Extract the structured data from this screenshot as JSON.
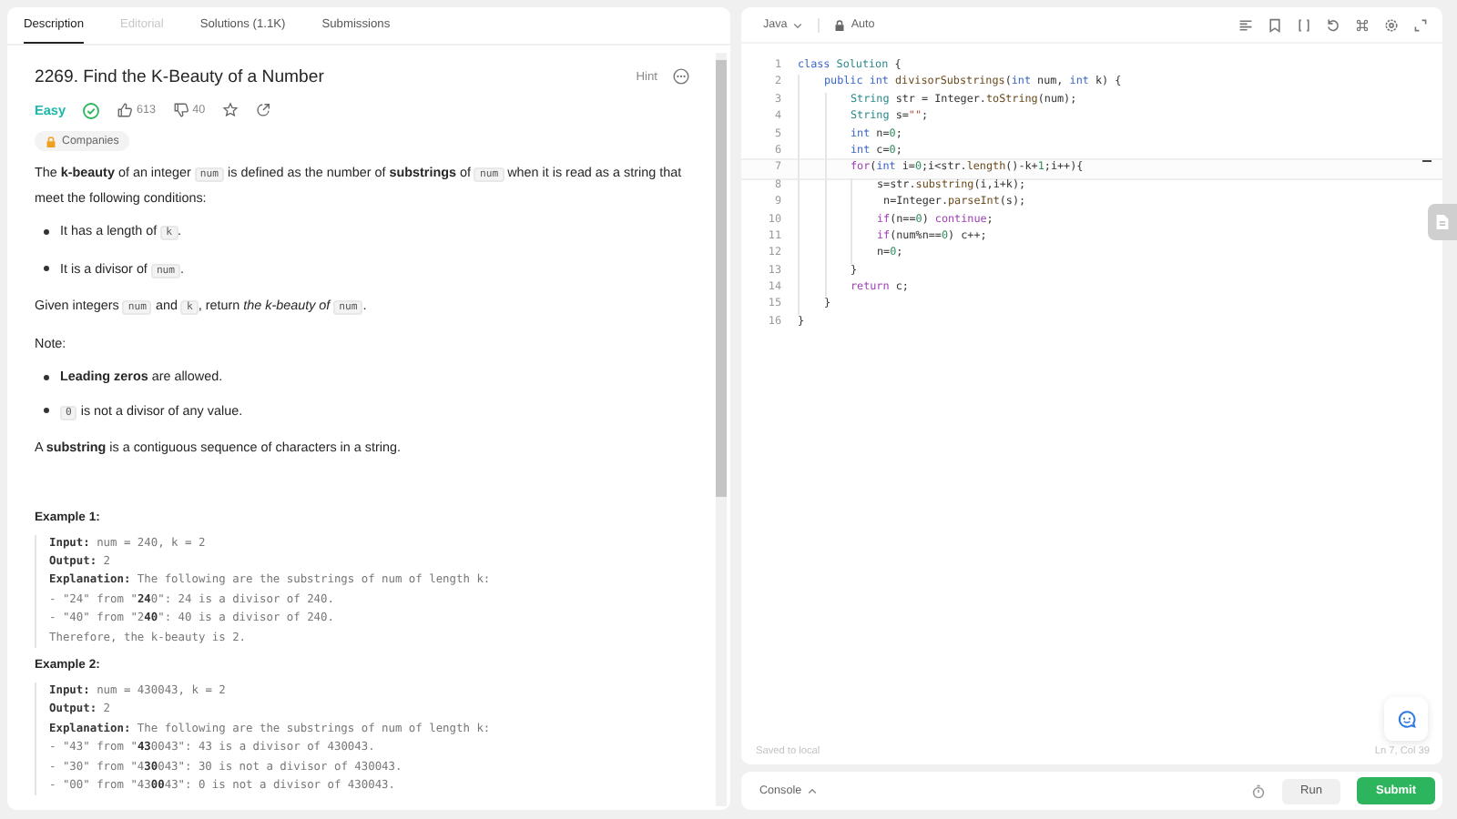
{
  "tabs": [
    {
      "label": "Description",
      "selected": true,
      "disabled": false
    },
    {
      "label": "Editorial",
      "selected": false,
      "disabled": true
    },
    {
      "label": "Solutions (1.1K)",
      "selected": false,
      "disabled": false
    },
    {
      "label": "Submissions",
      "selected": false,
      "disabled": false
    }
  ],
  "problem": {
    "title": "2269. Find the K-Beauty of a Number",
    "hint": "Hint",
    "difficulty": "Easy",
    "solved": true,
    "likes": "613",
    "dislikes": "40",
    "companies": "Companies"
  },
  "description": [
    {
      "kind": "p",
      "parts": [
        {
          "kind": "text",
          "text": "The **k-beauty** of an integer "
        },
        {
          "kind": "code",
          "text": "num"
        },
        {
          "kind": "text",
          "text": " is defined as the number of **substrings** of "
        },
        {
          "kind": "code",
          "text": "num"
        },
        {
          "kind": "text",
          "text": " when it is read as a string that meet the following conditions:"
        }
      ]
    },
    {
      "kind": "li",
      "parts": [
        {
          "kind": "text",
          "text": "It has a length of "
        },
        {
          "kind": "code",
          "text": "k"
        },
        {
          "kind": "text",
          "text": "."
        }
      ]
    },
    {
      "kind": "li",
      "parts": [
        {
          "kind": "text",
          "text": "It is a divisor of "
        },
        {
          "kind": "code",
          "text": "num"
        },
        {
          "kind": "text",
          "text": "."
        }
      ]
    },
    {
      "kind": "p",
      "parts": [
        {
          "kind": "text",
          "text": "Given integers "
        },
        {
          "kind": "code",
          "text": "num"
        },
        {
          "kind": "text",
          "text": " and "
        },
        {
          "kind": "code",
          "text": "k"
        },
        {
          "kind": "text",
          "text": ", return *the k-beauty of* "
        },
        {
          "kind": "code",
          "text": "num"
        },
        {
          "kind": "text",
          "text": "."
        }
      ]
    },
    {
      "kind": "p",
      "parts": [
        {
          "kind": "text",
          "text": "Note:"
        }
      ]
    },
    {
      "kind": "li",
      "parts": [
        {
          "kind": "text",
          "text": "**Leading zeros** are allowed."
        }
      ]
    },
    {
      "kind": "li",
      "parts": [
        {
          "kind": "code",
          "text": "0"
        },
        {
          "kind": "text",
          "text": " is not a divisor of any value."
        }
      ]
    },
    {
      "kind": "p",
      "parts": [
        {
          "kind": "text",
          "text": "A **substring** is a contiguous sequence of characters in a string."
        }
      ]
    }
  ],
  "examples": [
    {
      "title": "Example 1:",
      "lines": [
        "**Input:** num = 240, k = 2",
        "**Output:** 2",
        "**Explanation:** The following are the substrings of num of length k:",
        "- \"24\" from \"**24**0\": 24 is a divisor of 240.",
        "- \"40\" from \"2**40**\": 40 is a divisor of 240.",
        "Therefore, the k-beauty is 2."
      ]
    },
    {
      "title": "Example 2:",
      "lines": [
        "**Input:** num = 430043, k = 2",
        "**Output:** 2",
        "**Explanation:** The following are the substrings of num of length k:",
        "- \"43\" from \"**43**0043\": 43 is a divisor of 430043.",
        "- \"30\" from \"4**30**043\": 30 is not a divisor of 430043.",
        "- \"00\" from \"43**00**43\": 0 is not a divisor of 430043."
      ]
    }
  ],
  "editor": {
    "language": "Java",
    "mode": "Auto",
    "saved": "Saved to local",
    "position": "Ln 7, Col 39",
    "lines": [
      {
        "number": "1",
        "current": false,
        "tokens": [
          {
            "kind": "kw",
            "text": "class "
          },
          {
            "kind": "type",
            "text": "Solution"
          },
          {
            "kind": "plain",
            "text": " {"
          }
        ],
        "children": [
          {
            "number": "2",
            "current": false,
            "tokens": [
              {
                "kind": "kw",
                "text": "public int "
              },
              {
                "kind": "fn",
                "text": "divisorSubstrings"
              },
              {
                "kind": "plain",
                "text": "("
              },
              {
                "kind": "kw",
                "text": "int"
              },
              {
                "kind": "plain",
                "text": " num, "
              },
              {
                "kind": "kw",
                "text": "int"
              },
              {
                "kind": "plain",
                "text": " k) {"
              }
            ],
            "children": [
              {
                "number": "3",
                "current": false,
                "tokens": [
                  {
                    "kind": "type",
                    "text": "String"
                  },
                  {
                    "kind": "plain",
                    "text": " str = Integer."
                  },
                  {
                    "kind": "fn",
                    "text": "toString"
                  },
                  {
                    "kind": "plain",
                    "text": "(num);"
                  }
                ]
              },
              {
                "number": "4",
                "current": false,
                "tokens": [
                  {
                    "kind": "type",
                    "text": "String"
                  },
                  {
                    "kind": "plain",
                    "text": " s="
                  },
                  {
                    "kind": "str",
                    "text": "\"\""
                  },
                  {
                    "kind": "plain",
                    "text": ";"
                  }
                ]
              },
              {
                "number": "5",
                "current": false,
                "tokens": [
                  {
                    "kind": "kw",
                    "text": "int"
                  },
                  {
                    "kind": "plain",
                    "text": " n="
                  },
                  {
                    "kind": "num",
                    "text": "0"
                  },
                  {
                    "kind": "plain",
                    "text": ";"
                  }
                ]
              },
              {
                "number": "6",
                "current": false,
                "tokens": [
                  {
                    "kind": "kw",
                    "text": "int"
                  },
                  {
                    "kind": "plain",
                    "text": " c="
                  },
                  {
                    "kind": "num",
                    "text": "0"
                  },
                  {
                    "kind": "plain",
                    "text": ";"
                  }
                ]
              },
              {
                "number": "7",
                "current": true,
                "tokens": [
                  {
                    "kind": "ctl",
                    "text": "for"
                  },
                  {
                    "kind": "plain",
                    "text": "("
                  },
                  {
                    "kind": "kw",
                    "text": "int"
                  },
                  {
                    "kind": "plain",
                    "text": " i="
                  },
                  {
                    "kind": "num",
                    "text": "0"
                  },
                  {
                    "kind": "plain",
                    "text": ";i<str."
                  },
                  {
                    "kind": "fn",
                    "text": "length"
                  },
                  {
                    "kind": "plain",
                    "text": "()-k+"
                  },
                  {
                    "kind": "num",
                    "text": "1"
                  },
                  {
                    "kind": "plain",
                    "text": ";i++){"
                  }
                ],
                "children": [
                  {
                    "number": "8",
                    "current": false,
                    "tokens": [
                      {
                        "kind": "plain",
                        "text": "s=str."
                      },
                      {
                        "kind": "fn",
                        "text": "substring"
                      },
                      {
                        "kind": "plain",
                        "text": "(i,i+k);"
                      }
                    ]
                  },
                  {
                    "number": "9",
                    "current": false,
                    "tokens": [
                      {
                        "kind": "plain",
                        "text": " n=Integer."
                      },
                      {
                        "kind": "fn",
                        "text": "parseInt"
                      },
                      {
                        "kind": "plain",
                        "text": "(s);"
                      }
                    ]
                  },
                  {
                    "number": "10",
                    "current": false,
                    "tokens": [
                      {
                        "kind": "ctl",
                        "text": "if"
                      },
                      {
                        "kind": "plain",
                        "text": "(n=="
                      },
                      {
                        "kind": "num",
                        "text": "0"
                      },
                      {
                        "kind": "plain",
                        "text": ") "
                      },
                      {
                        "kind": "ctl",
                        "text": "continue"
                      },
                      {
                        "kind": "plain",
                        "text": ";"
                      }
                    ]
                  },
                  {
                    "number": "11",
                    "current": false,
                    "tokens": [
                      {
                        "kind": "ctl",
                        "text": "if"
                      },
                      {
                        "kind": "plain",
                        "text": "(num%n=="
                      },
                      {
                        "kind": "num",
                        "text": "0"
                      },
                      {
                        "kind": "plain",
                        "text": ") c++;"
                      }
                    ]
                  },
                  {
                    "number": "12",
                    "current": false,
                    "tokens": [
                      {
                        "kind": "plain",
                        "text": "n="
                      },
                      {
                        "kind": "num",
                        "text": "0"
                      },
                      {
                        "kind": "plain",
                        "text": ";"
                      }
                    ]
                  }
                ]
              },
              {
                "number": "13",
                "current": false,
                "tokens": [
                  {
                    "kind": "plain",
                    "text": "}"
                  }
                ]
              },
              {
                "number": "14",
                "current": false,
                "tokens": [
                  {
                    "kind": "ctl",
                    "text": "return"
                  },
                  {
                    "kind": "plain",
                    "text": " c;"
                  }
                ]
              }
            ]
          },
          {
            "number": "15",
            "current": false,
            "tokens": [
              {
                "kind": "plain",
                "text": "}"
              }
            ]
          }
        ]
      },
      {
        "number": "16",
        "current": false,
        "tokens": [
          {
            "kind": "plain",
            "text": "}"
          }
        ]
      }
    ]
  },
  "console": {
    "label": "Console",
    "run": "Run",
    "submit": "Submit"
  }
}
